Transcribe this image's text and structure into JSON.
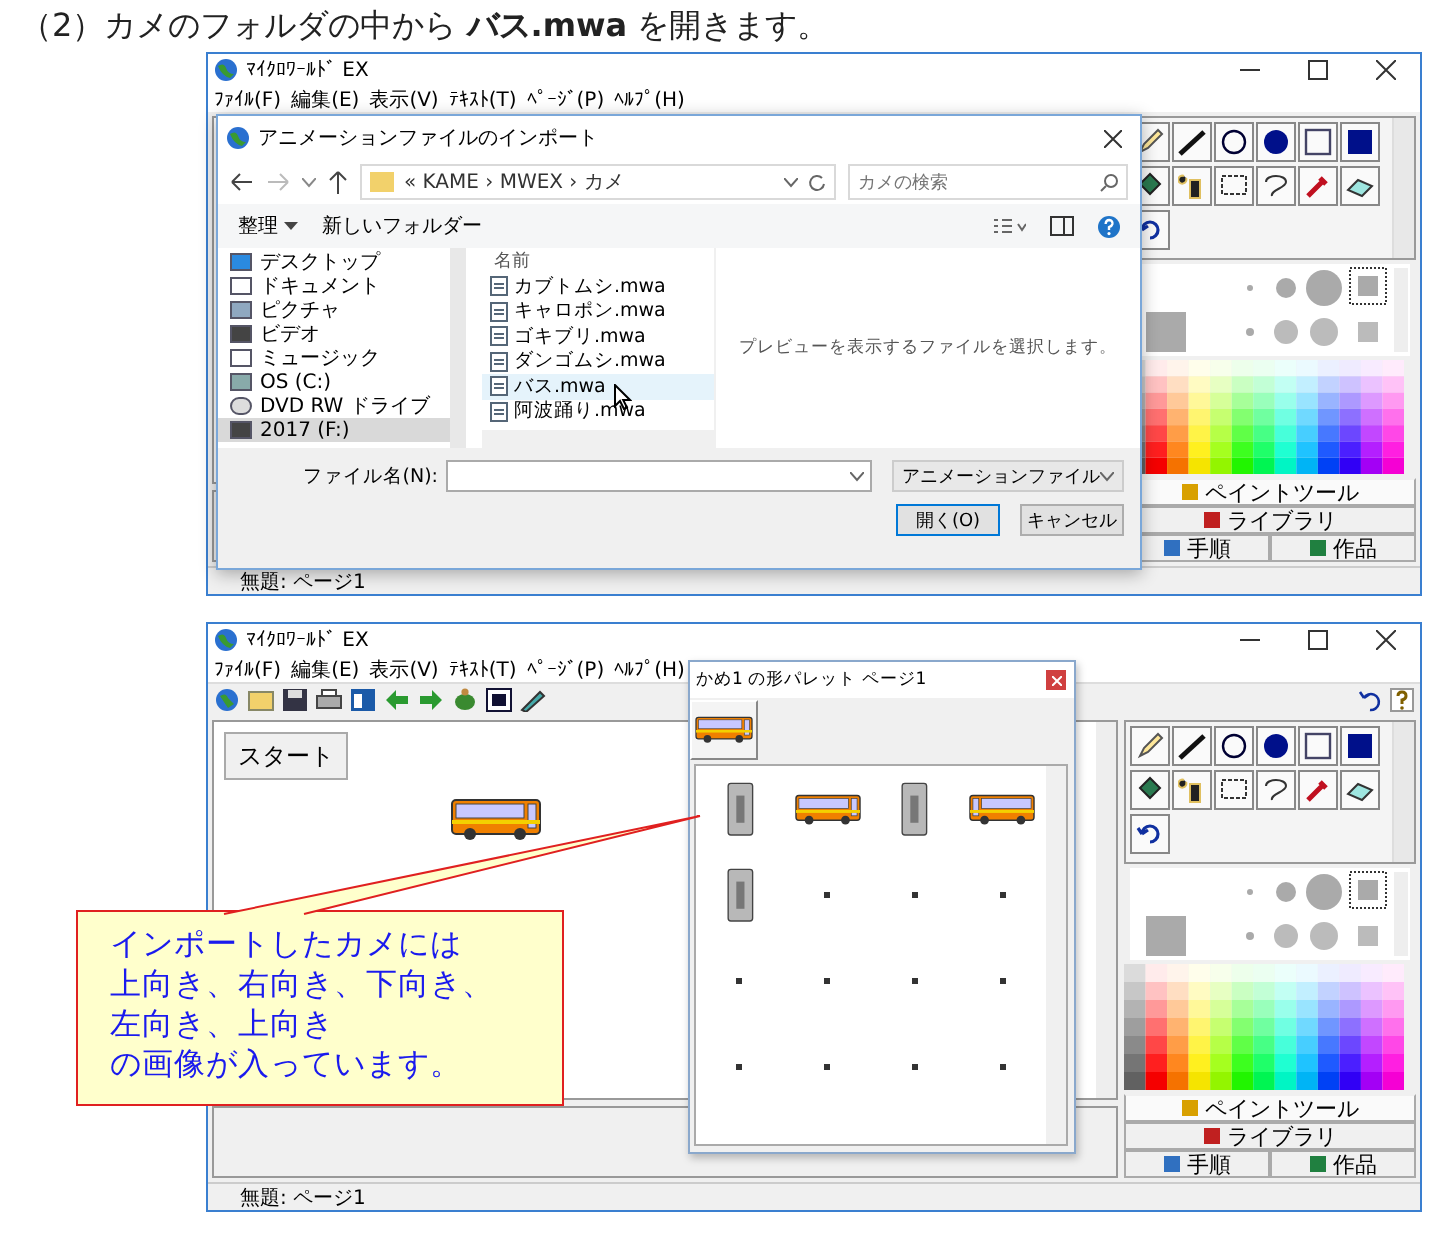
{
  "heading": "（2）カメのフォルダの中から **バス.mwa** を開きます。",
  "import_screen": {
    "app": {
      "title": "ﾏｲｸﾛﾜｰﾙﾄﾞ EX",
      "menu": [
        "ﾌｧｲﾙ(F)",
        "編集(E)",
        "表示(V)",
        "ﾃｷｽﾄ(T)",
        "ﾍﾟｰｼﾞ(P)",
        "ﾍﾙﾌﾟ(H)"
      ],
      "tabs": [
        {
          "label": "ペイントツール",
          "selected": true
        },
        {
          "label": "ライブラリ",
          "selected": false
        },
        {
          "label": "手順",
          "selected": false
        },
        {
          "label": "作品",
          "selected": false
        }
      ],
      "status": "無題: ページ1"
    },
    "dialog": {
      "title": "アニメーションファイルのインポート",
      "address": "« KAME › MWEX › カメ",
      "search_placeholder": "カメの検索",
      "organize": "整理",
      "new_folder": "新しいフォルダー",
      "places": [
        {
          "label": "デスクトップ",
          "selected": false
        },
        {
          "label": "ドキュメント",
          "selected": false
        },
        {
          "label": "ピクチャ",
          "selected": false
        },
        {
          "label": "ビデオ",
          "selected": false
        },
        {
          "label": "ミュージック",
          "selected": false
        },
        {
          "label": "OS (C:)",
          "selected": false
        },
        {
          "label": "DVD RW ドライブ",
          "selected": false
        },
        {
          "label": "2017 (F:)",
          "selected": true
        }
      ],
      "column": "名前",
      "files": [
        {
          "name": "カブトムシ.mwa",
          "selected": false
        },
        {
          "name": "キャロポン.mwa",
          "selected": false
        },
        {
          "name": "ゴキブリ.mwa",
          "selected": false
        },
        {
          "name": "ダンゴムシ.mwa",
          "selected": false
        },
        {
          "name": "バス.mwa",
          "selected": true
        },
        {
          "name": "阿波踊り.mwa",
          "selected": false
        }
      ],
      "preview": "プレビューを表示するファイルを選択します。",
      "filename_label": "ファイル名(N):",
      "file_type": "アニメーションファイル",
      "buttons": [
        {
          "label": "開く(O)",
          "default": true
        },
        {
          "label": "キャンセル",
          "default": false
        }
      ]
    }
  },
  "palette_screen": {
    "app": {
      "title": "ﾏｲｸﾛﾜｰﾙﾄﾞ EX",
      "menu": [
        "ﾌｧｲﾙ(F)",
        "編集(E)",
        "表示(V)",
        "ﾃｷｽﾄ(T)",
        "ﾍﾟｰｼﾞ(P)",
        "ﾍﾙﾌﾟ(H)"
      ],
      "tabs": [
        {
          "label": "ペイントツール",
          "selected": true
        },
        {
          "label": "ライブラリ",
          "selected": false
        },
        {
          "label": "手順",
          "selected": false
        },
        {
          "label": "作品",
          "selected": false
        }
      ],
      "status": "無題: ページ1"
    },
    "start_button": "スタート",
    "canvas_shape": {
      "kind": "bus-right"
    },
    "palette": {
      "title": "かめ1 の形パレット ページ1",
      "current": {
        "kind": "bus-right"
      },
      "cells": [
        {
          "kind": "bus-top"
        },
        {
          "kind": "bus-right"
        },
        {
          "kind": "bus-top"
        },
        {
          "kind": "bus-left"
        },
        {
          "kind": "bus-top"
        },
        {
          "kind": "dot"
        },
        {
          "kind": "dot"
        },
        {
          "kind": "dot"
        },
        {
          "kind": "dot"
        },
        {
          "kind": "dot"
        },
        {
          "kind": "dot"
        },
        {
          "kind": "dot"
        },
        {
          "kind": "dot"
        },
        {
          "kind": "dot"
        },
        {
          "kind": "dot"
        },
        {
          "kind": "dot"
        }
      ]
    },
    "callout": {
      "lines": [
        "インポートしたカメには",
        "上向き、右向き、下向き、",
        "左向き、上向き",
        "の画像が入っています。"
      ]
    }
  }
}
